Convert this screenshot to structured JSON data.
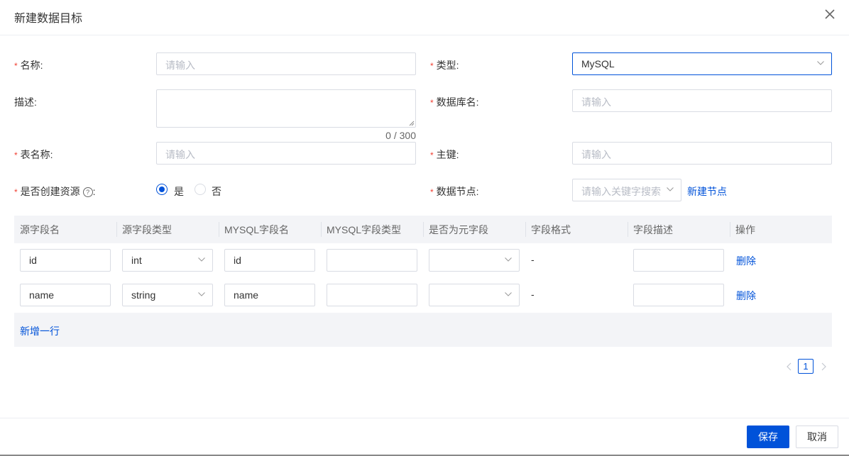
{
  "dialog": {
    "title": "新建数据目标"
  },
  "form": {
    "required_mark": "*",
    "name": {
      "label": "名称:",
      "placeholder": "请输入"
    },
    "type": {
      "label": "类型:",
      "value": "MySQL"
    },
    "description": {
      "label": "描述:",
      "counter": "0 / 300"
    },
    "database": {
      "label": "数据库名:",
      "placeholder": "请输入"
    },
    "table_name": {
      "label": "表名称:",
      "placeholder": "请输入"
    },
    "primary_key": {
      "label": "主键:",
      "placeholder": "请输入"
    },
    "create_resource": {
      "label": "是否创建资源",
      "help_icon": "?",
      "colon": ":",
      "options": [
        "是",
        "否"
      ],
      "selected": "是"
    },
    "data_node": {
      "label": "数据节点:",
      "placeholder": "请输入关键字搜索",
      "new_node_link": "新建节点"
    }
  },
  "table": {
    "headers": [
      "源字段名",
      "源字段类型",
      "MYSQL字段名",
      "MYSQL字段类型",
      "是否为元字段",
      "字段格式",
      "字段描述",
      "操作"
    ],
    "rows": [
      {
        "source_name": "id",
        "source_type": "int",
        "mysql_name": "id",
        "mysql_type": "",
        "is_meta": "",
        "format": "-",
        "desc": "",
        "action": "删除"
      },
      {
        "source_name": "name",
        "source_type": "string",
        "mysql_name": "name",
        "mysql_type": "",
        "is_meta": "",
        "format": "-",
        "desc": "",
        "action": "删除"
      }
    ],
    "add_row": "新增一行"
  },
  "pagination": {
    "current_page": "1"
  },
  "footer": {
    "save": "保存",
    "cancel": "取消"
  },
  "colors": {
    "primary": "#0052d9",
    "required": "#f04134",
    "border": "#d9dce3",
    "table_header_bg": "#f3f4f7"
  },
  "icons": {
    "close": "close-icon",
    "chevron": "chevron-down-icon",
    "help": "help-circle-icon",
    "prev": "chevron-left-icon",
    "next": "chevron-right-icon"
  }
}
